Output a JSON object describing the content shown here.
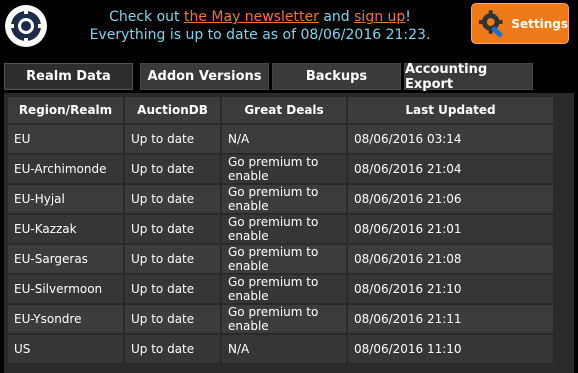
{
  "header": {
    "line1_prefix": "Check out ",
    "newsletter_link": "the May newsletter",
    "line1_mid": " and ",
    "signup_link": "sign up",
    "line1_suffix": "!",
    "line2": "Everything is up to date as of 08/06/2016 21:23."
  },
  "settings": {
    "label": "Settings",
    "icon": "gear-wrench-icon"
  },
  "tabs": [
    {
      "label": "Realm Data",
      "active": true
    },
    {
      "label": "Addon Versions",
      "active": false
    },
    {
      "label": "Backups",
      "active": false
    },
    {
      "label": "Accounting Export",
      "active": false
    }
  ],
  "table": {
    "headers": [
      "Region/Realm",
      "AuctionDB",
      "Great Deals",
      "Last Updated"
    ],
    "rows": [
      [
        "EU",
        "Up to date",
        "N/A",
        "08/06/2016 03:14"
      ],
      [
        "EU-Archimonde",
        "Up to date",
        "Go premium to enable",
        "08/06/2016 21:04"
      ],
      [
        "EU-Hyjal",
        "Up to date",
        "Go premium to enable",
        "08/06/2016 21:06"
      ],
      [
        "EU-Kazzak",
        "Up to date",
        "Go premium to enable",
        "08/06/2016 21:01"
      ],
      [
        "EU-Sargeras",
        "Up to date",
        "Go premium to enable",
        "08/06/2016 21:08"
      ],
      [
        "EU-Silvermoon",
        "Up to date",
        "Go premium to enable",
        "08/06/2016 21:10"
      ],
      [
        "EU-Ysondre",
        "Up to date",
        "Go premium to enable",
        "08/06/2016 21:11"
      ],
      [
        "US",
        "Up to date",
        "N/A",
        "08/06/2016 11:10"
      ]
    ]
  }
}
